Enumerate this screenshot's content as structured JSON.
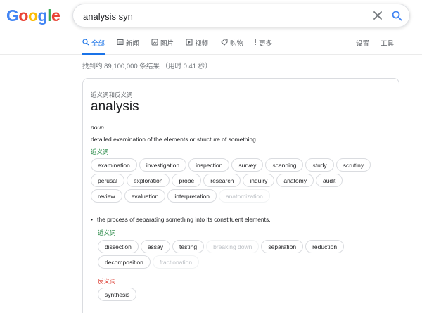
{
  "logo": {
    "letters": [
      "G",
      "o",
      "o",
      "g",
      "l",
      "e"
    ],
    "colors": [
      "#4285f4",
      "#ea4335",
      "#fbbc05",
      "#4285f4",
      "#34a853",
      "#ea4335"
    ]
  },
  "search": {
    "query": "analysis syn",
    "clear_icon": "close-icon",
    "search_icon": "search-icon"
  },
  "tabs": [
    {
      "label": "全部",
      "icon": "search-icon",
      "active": true
    },
    {
      "label": "新闻",
      "icon": "news-icon",
      "active": false
    },
    {
      "label": "图片",
      "icon": "image-icon",
      "active": false
    },
    {
      "label": "视频",
      "icon": "video-icon",
      "active": false
    },
    {
      "label": "购物",
      "icon": "tag-icon",
      "active": false
    },
    {
      "label": "更多",
      "icon": "more-vert-icon",
      "active": false
    }
  ],
  "tools": {
    "settings": "设置",
    "tools": "工具"
  },
  "stats": "找到约 89,100,000 条结果 （用时 0.41 秒）",
  "dictionary": {
    "header": "近义词和反义词",
    "word": "analysis",
    "part_of_speech": "noun",
    "sense1": {
      "definition": "detailed examination of the elements or structure of something.",
      "synonyms_label": "近义词",
      "synonyms": [
        {
          "text": "examination",
          "enabled": true
        },
        {
          "text": "investigation",
          "enabled": true
        },
        {
          "text": "inspection",
          "enabled": true
        },
        {
          "text": "survey",
          "enabled": true
        },
        {
          "text": "scanning",
          "enabled": true
        },
        {
          "text": "study",
          "enabled": true
        },
        {
          "text": "scrutiny",
          "enabled": true
        },
        {
          "text": "perusal",
          "enabled": true
        },
        {
          "text": "exploration",
          "enabled": true
        },
        {
          "text": "probe",
          "enabled": true
        },
        {
          "text": "research",
          "enabled": true
        },
        {
          "text": "inquiry",
          "enabled": true
        },
        {
          "text": "anatomy",
          "enabled": true
        },
        {
          "text": "audit",
          "enabled": true
        },
        {
          "text": "review",
          "enabled": true
        },
        {
          "text": "evaluation",
          "enabled": true
        },
        {
          "text": "interpretation",
          "enabled": true
        },
        {
          "text": "anatomization",
          "enabled": false
        }
      ]
    },
    "sense2": {
      "bullet": "•",
      "definition": "the process of separating something into its constituent elements.",
      "synonyms_label": "近义词",
      "synonyms": [
        {
          "text": "dissection",
          "enabled": true
        },
        {
          "text": "assay",
          "enabled": true
        },
        {
          "text": "testing",
          "enabled": true
        },
        {
          "text": "breaking down",
          "enabled": false
        },
        {
          "text": "separation",
          "enabled": true
        },
        {
          "text": "reduction",
          "enabled": true
        },
        {
          "text": "decomposition",
          "enabled": true
        },
        {
          "text": "fractionation",
          "enabled": false
        }
      ],
      "antonyms_label": "反义词",
      "antonyms": [
        {
          "text": "synthesis",
          "enabled": true
        }
      ]
    }
  }
}
